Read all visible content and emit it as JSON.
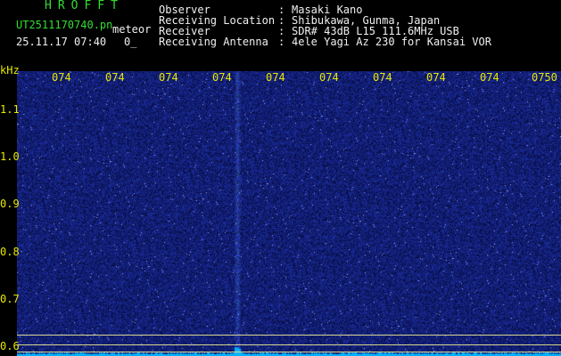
{
  "header": {
    "logo": "HROFFT",
    "filename": "UT2511170740.pn",
    "mode": "meteor",
    "datetime": "25.11.17 07:40",
    "count": "0_"
  },
  "info": [
    {
      "label": "Observer",
      "colon": ":",
      "value": "Masaki Kano"
    },
    {
      "label": "Receiving Location",
      "colon": ":",
      "value": "Shibukawa, Gunma, Japan"
    },
    {
      "label": "Receiver",
      "colon": ":",
      "value": "SDR# 43dB L15 111.6MHz USB"
    },
    {
      "label": "Receiving Antenna",
      "colon": ":",
      "value": "4ele Yagi Az 230 for Kansai VOR"
    }
  ],
  "spectrogram": {
    "y_unit": "kHz",
    "y_ticks": [
      {
        "label": "1.1",
        "value": 1.1
      },
      {
        "label": "1.0",
        "value": 1.0
      },
      {
        "label": "0.9",
        "value": 0.9
      },
      {
        "label": "0.8",
        "value": 0.8
      },
      {
        "label": "0.7",
        "value": 0.7
      },
      {
        "label": "0.6",
        "value": 0.6
      }
    ],
    "x_ticks": [
      "074",
      "074",
      "074",
      "074",
      "074",
      "074",
      "074",
      "074",
      "074",
      "0750"
    ],
    "y_range": [
      0.58,
      1.18
    ],
    "marker_lines_khz": [
      0.625,
      0.605,
      0.59
    ],
    "colors": {
      "background": "#070b4e",
      "noise": "#2a3ab0",
      "signal": "#4060ff",
      "baseline": "#00b4ff",
      "marker": "#d8d890",
      "header_green": "#33dd33",
      "label_yellow": "#e8e800"
    }
  }
}
